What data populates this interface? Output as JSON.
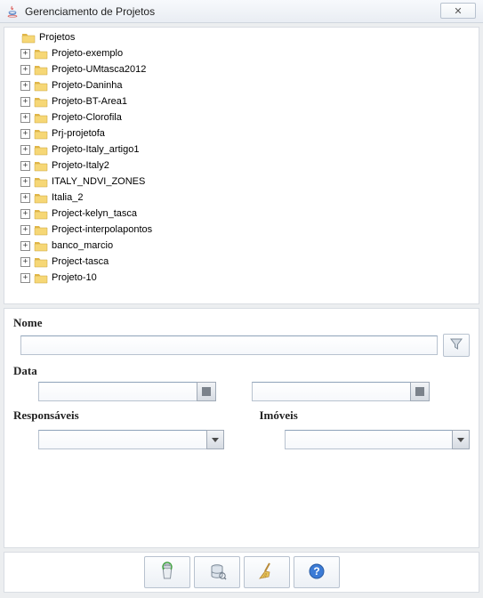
{
  "window": {
    "title": "Gerenciamento de Projetos",
    "close_glyph": "✕"
  },
  "tree": {
    "root_label": "Projetos",
    "items": [
      "Projeto-exemplo",
      "Projeto-UMtasca2012",
      "Projeto-Daninha",
      "Projeto-BT-Area1",
      "Projeto-Clorofila",
      "Prj-projetofa",
      "Projeto-Italy_artigo1",
      "Projeto-Italy2",
      "ITALY_NDVI_ZONES",
      "Italia_2",
      "Project-kelyn_tasca",
      "Project-interpolapontos",
      "banco_marcio",
      "Project-tasca",
      "Projeto-10"
    ]
  },
  "form": {
    "nome_label": "Nome",
    "nome_value": "",
    "data_label": "Data",
    "date_from": "",
    "date_to": "",
    "responsaveis_label": "Responsáveis",
    "responsaveis_value": "",
    "imoveis_label": "Imóveis",
    "imoveis_value": ""
  },
  "icons": {
    "java": "java-coffee-icon",
    "filter": "funnel-icon",
    "calendar": "calendar-picker-icon",
    "recycle": "recycle-bin-icon",
    "database": "database-icon",
    "broom": "broom-icon",
    "help": "help-icon"
  }
}
